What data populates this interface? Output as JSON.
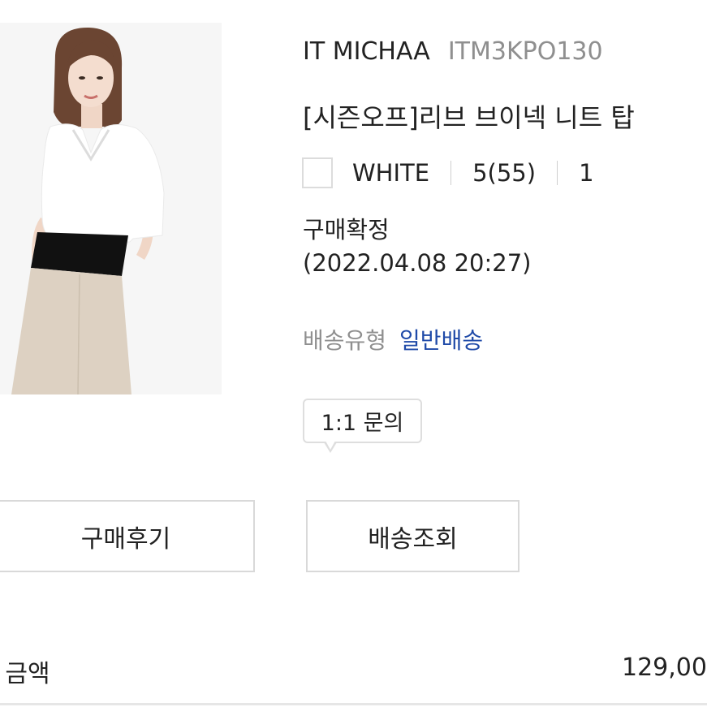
{
  "product": {
    "brand": "IT MICHAA",
    "code": "ITM3KPO130",
    "name": "[시즌오프]리브 브이넥 니트 탑",
    "color": "WHITE",
    "size": "5(55)",
    "quantity": "1"
  },
  "order": {
    "status": "구매확정",
    "date": "(2022.04.08 20:27)"
  },
  "shipping": {
    "label": "배송유형",
    "type": "일반배송"
  },
  "buttons": {
    "inquiry": "1:1 문의",
    "review": "구매후기",
    "track": "배송조회"
  },
  "total": {
    "label": "- 금액",
    "value": "129,00"
  },
  "colors": {
    "link_blue": "#1f4aa8",
    "muted_gray": "#8f8f8f",
    "border": "#d9d9d9"
  }
}
